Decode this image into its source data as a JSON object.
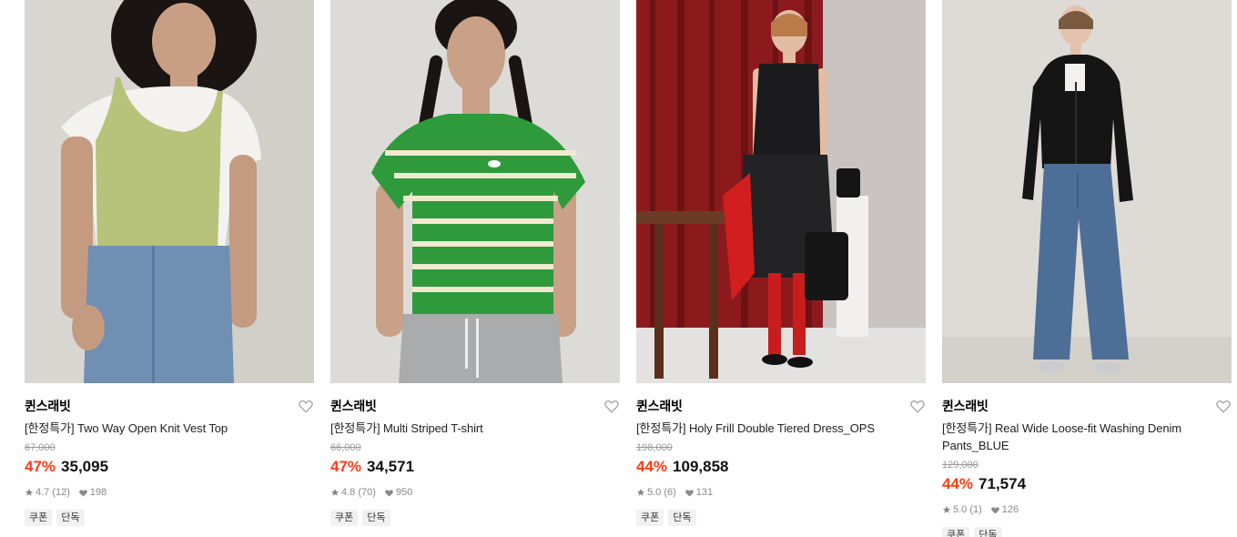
{
  "products": [
    {
      "brand": "퀸스래빗",
      "title": "[한정특가] Two Way Open Knit Vest Top",
      "original_price": "67,000",
      "discount": "47%",
      "price": "35,095",
      "rating": "4.7 (12)",
      "likes": "198",
      "tags": [
        "쿠폰",
        "단독"
      ]
    },
    {
      "brand": "퀸스래빗",
      "title": "[한정특가] Multi Striped T-shirt",
      "original_price": "66,000",
      "discount": "47%",
      "price": "34,571",
      "rating": "4.8 (70)",
      "likes": "950",
      "tags": [
        "쿠폰",
        "단독"
      ]
    },
    {
      "brand": "퀸스래빗",
      "title": "[한정특가] Holy Frill Double Tiered Dress_OPS",
      "original_price": "198,000",
      "discount": "44%",
      "price": "109,858",
      "rating": "5.0 (6)",
      "likes": "131",
      "tags": [
        "쿠폰",
        "단독"
      ]
    },
    {
      "brand": "퀸스래빗",
      "title": "[한정특가] Real Wide Loose-fit Washing Denim Pants_BLUE",
      "original_price": "129,000",
      "discount": "44%",
      "price": "71,574",
      "rating": "5.0 (1)",
      "likes": "126",
      "tags": [
        "쿠폰",
        "단독"
      ]
    }
  ],
  "icons": {
    "wishlist": "heart-outline-icon",
    "rating": "star-icon",
    "likes": "heart-filled-icon"
  },
  "colors": {
    "discount": "#ff3b16",
    "original_price": "#999999",
    "tag_bg": "#f1f1f1"
  }
}
